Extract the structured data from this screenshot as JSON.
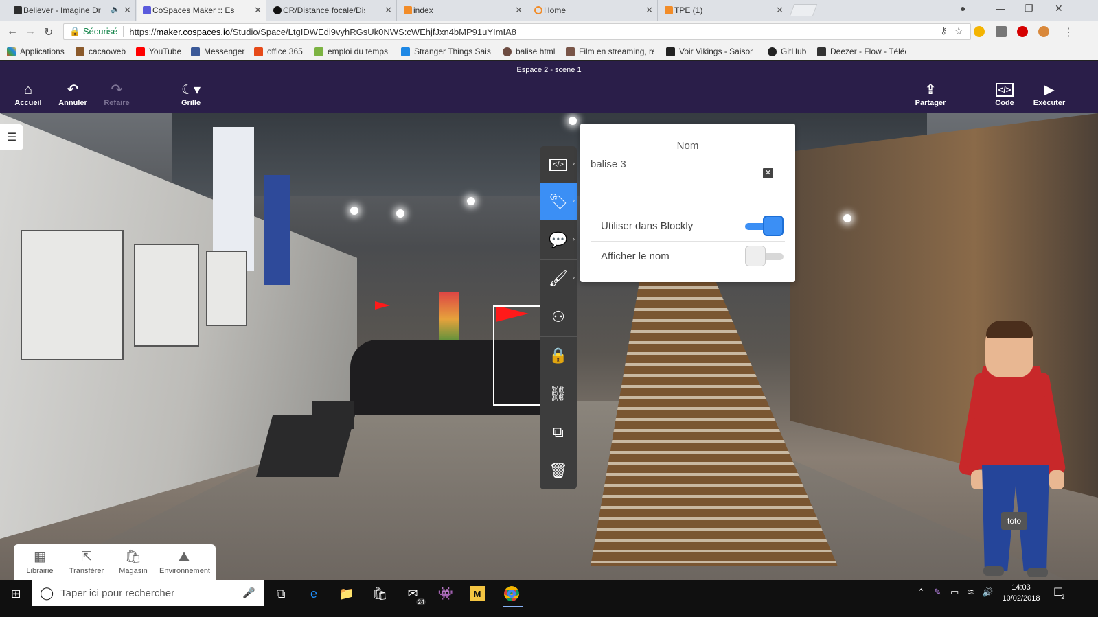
{
  "browser": {
    "tabs": [
      {
        "title": "Believer - Imagine Dr",
        "color": "#2e2e2e",
        "active": false
      },
      {
        "title": "CoSpaces Maker :: Espac",
        "color": "#5b5bdc",
        "active": true
      },
      {
        "title": "CR/Distance focale/Dista",
        "color": "#111111",
        "active": false
      },
      {
        "title": "index",
        "color": "#f28c28",
        "active": false
      },
      {
        "title": "Home",
        "color": "#f28c28",
        "active": false
      },
      {
        "title": "TPE (1)",
        "color": "#f28c28",
        "active": false
      }
    ],
    "secure_label": "Sécurisé",
    "url_prefix": "https://",
    "url_host": "maker.cospaces.io",
    "url_path": "/Studio/Space/LtgIDWEdi9vyhRGsUk0NWS:cWEhjfJxn4bMP91uYImIA8",
    "bookmarks": [
      {
        "label": "Applications",
        "color": "#e53935"
      },
      {
        "label": "cacaoweb",
        "color": "#8b5a2b"
      },
      {
        "label": "YouTube",
        "color": "#ff0000"
      },
      {
        "label": "Messenger",
        "color": "#3b5998"
      },
      {
        "label": "office 365",
        "color": "#e64a19"
      },
      {
        "label": "emploi du temps",
        "color": "#7cb342"
      },
      {
        "label": "Stranger Things Saiso",
        "color": "#1e88e5"
      },
      {
        "label": "balise html",
        "color": "#6d4c41"
      },
      {
        "label": "Film en streaming, re",
        "color": "#795548"
      },
      {
        "label": "Voir Vikings - Saison",
        "color": "#222222"
      },
      {
        "label": "GitHub",
        "color": "#222222"
      },
      {
        "label": "Deezer - Flow - Téléc",
        "color": "#333333"
      }
    ]
  },
  "app": {
    "scene_title": "Espace 2 - scene 1",
    "header_buttons": {
      "home": "Accueil",
      "undo": "Annuler",
      "redo": "Refaire",
      "grid": "Grille",
      "share": "Partager",
      "code": "Code",
      "run": "Exécuter"
    },
    "properties": {
      "name_label": "Nom",
      "name_value": "balise 3",
      "blockly_label": "Utiliser dans Blockly",
      "blockly_on": true,
      "show_name_label": "Afficher le nom",
      "show_name_on": false
    },
    "character_label": "toto",
    "bottom_panel": {
      "library": "Librairie",
      "transfer": "Transférer",
      "store": "Magasin",
      "environment": "Environnement"
    }
  },
  "taskbar": {
    "search_placeholder": "Taper ici pour rechercher",
    "mail_badge": "24",
    "time": "14:03",
    "date": "10/02/2018",
    "notif_count": "2"
  },
  "colors": {
    "accent": "#3b8ff5",
    "header_bg": "#2a1e49"
  }
}
